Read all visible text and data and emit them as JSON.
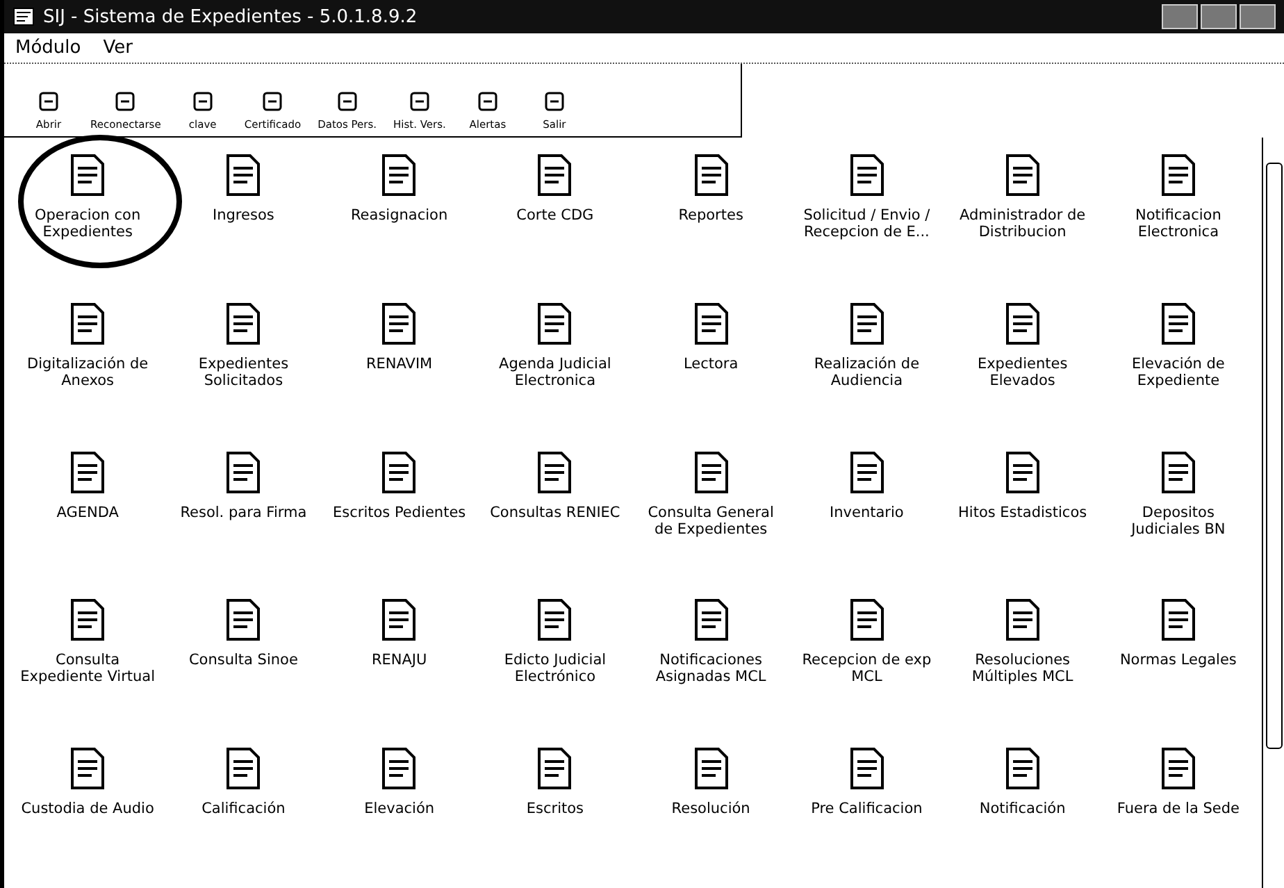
{
  "window": {
    "title": "SIJ - Sistema de Expedientes - 5.0.1.8.9.2"
  },
  "menu": [
    "Módulo",
    "Ver"
  ],
  "toolbar": [
    "Abrir",
    "Reconectarse",
    "clave",
    "Certificado",
    "Datos Pers.",
    "Hist. Vers.",
    "Alertas",
    "Salir"
  ],
  "modules": [
    {
      "label": "Operacion con Expedientes",
      "circled": true
    },
    {
      "label": "Ingresos",
      "circled": false
    },
    {
      "label": "Reasignacion",
      "circled": false
    },
    {
      "label": "Corte CDG",
      "circled": false
    },
    {
      "label": "Reportes",
      "circled": false
    },
    {
      "label": "Solicitud / Envio / Recepcion de E...",
      "circled": false
    },
    {
      "label": "Administrador de Distribucion",
      "circled": false
    },
    {
      "label": "Notificacion Electronica",
      "circled": false
    },
    {
      "label": "Digitalización de Anexos",
      "circled": false
    },
    {
      "label": "Expedientes Solicitados",
      "circled": false
    },
    {
      "label": "RENAVIM",
      "circled": false
    },
    {
      "label": "Agenda Judicial Electronica",
      "circled": false
    },
    {
      "label": "Lectora",
      "circled": false
    },
    {
      "label": "Realización de Audiencia",
      "circled": false
    },
    {
      "label": "Expedientes Elevados",
      "circled": false
    },
    {
      "label": "Elevación de Expediente",
      "circled": false
    },
    {
      "label": "AGENDA",
      "circled": false
    },
    {
      "label": "Resol. para Firma",
      "circled": false
    },
    {
      "label": "Escritos Pedientes",
      "circled": false
    },
    {
      "label": "Consultas RENIEC",
      "circled": false
    },
    {
      "label": "Consulta General de Expedientes",
      "circled": false
    },
    {
      "label": "Inventario",
      "circled": false
    },
    {
      "label": "Hitos Estadisticos",
      "circled": false
    },
    {
      "label": "Depositos Judiciales BN",
      "circled": false
    },
    {
      "label": "Consulta Expediente Virtual",
      "circled": false
    },
    {
      "label": "Consulta Sinoe",
      "circled": false
    },
    {
      "label": "RENAJU",
      "circled": false
    },
    {
      "label": "Edicto Judicial Electrónico",
      "circled": false
    },
    {
      "label": "Notificaciones Asignadas MCL",
      "circled": false
    },
    {
      "label": "Recepcion de exp MCL",
      "circled": false
    },
    {
      "label": "Resoluciones Múltiples MCL",
      "circled": false
    },
    {
      "label": "Normas Legales",
      "circled": false
    },
    {
      "label": "Custodia de Audio",
      "circled": false
    },
    {
      "label": "Calificación",
      "circled": false
    },
    {
      "label": "Elevación",
      "circled": false
    },
    {
      "label": "Escritos",
      "circled": false
    },
    {
      "label": "Resolución",
      "circled": false
    },
    {
      "label": "Pre Calificacion",
      "circled": false
    },
    {
      "label": "Notificación",
      "circled": false
    },
    {
      "label": "Fuera de la Sede",
      "circled": false
    }
  ]
}
